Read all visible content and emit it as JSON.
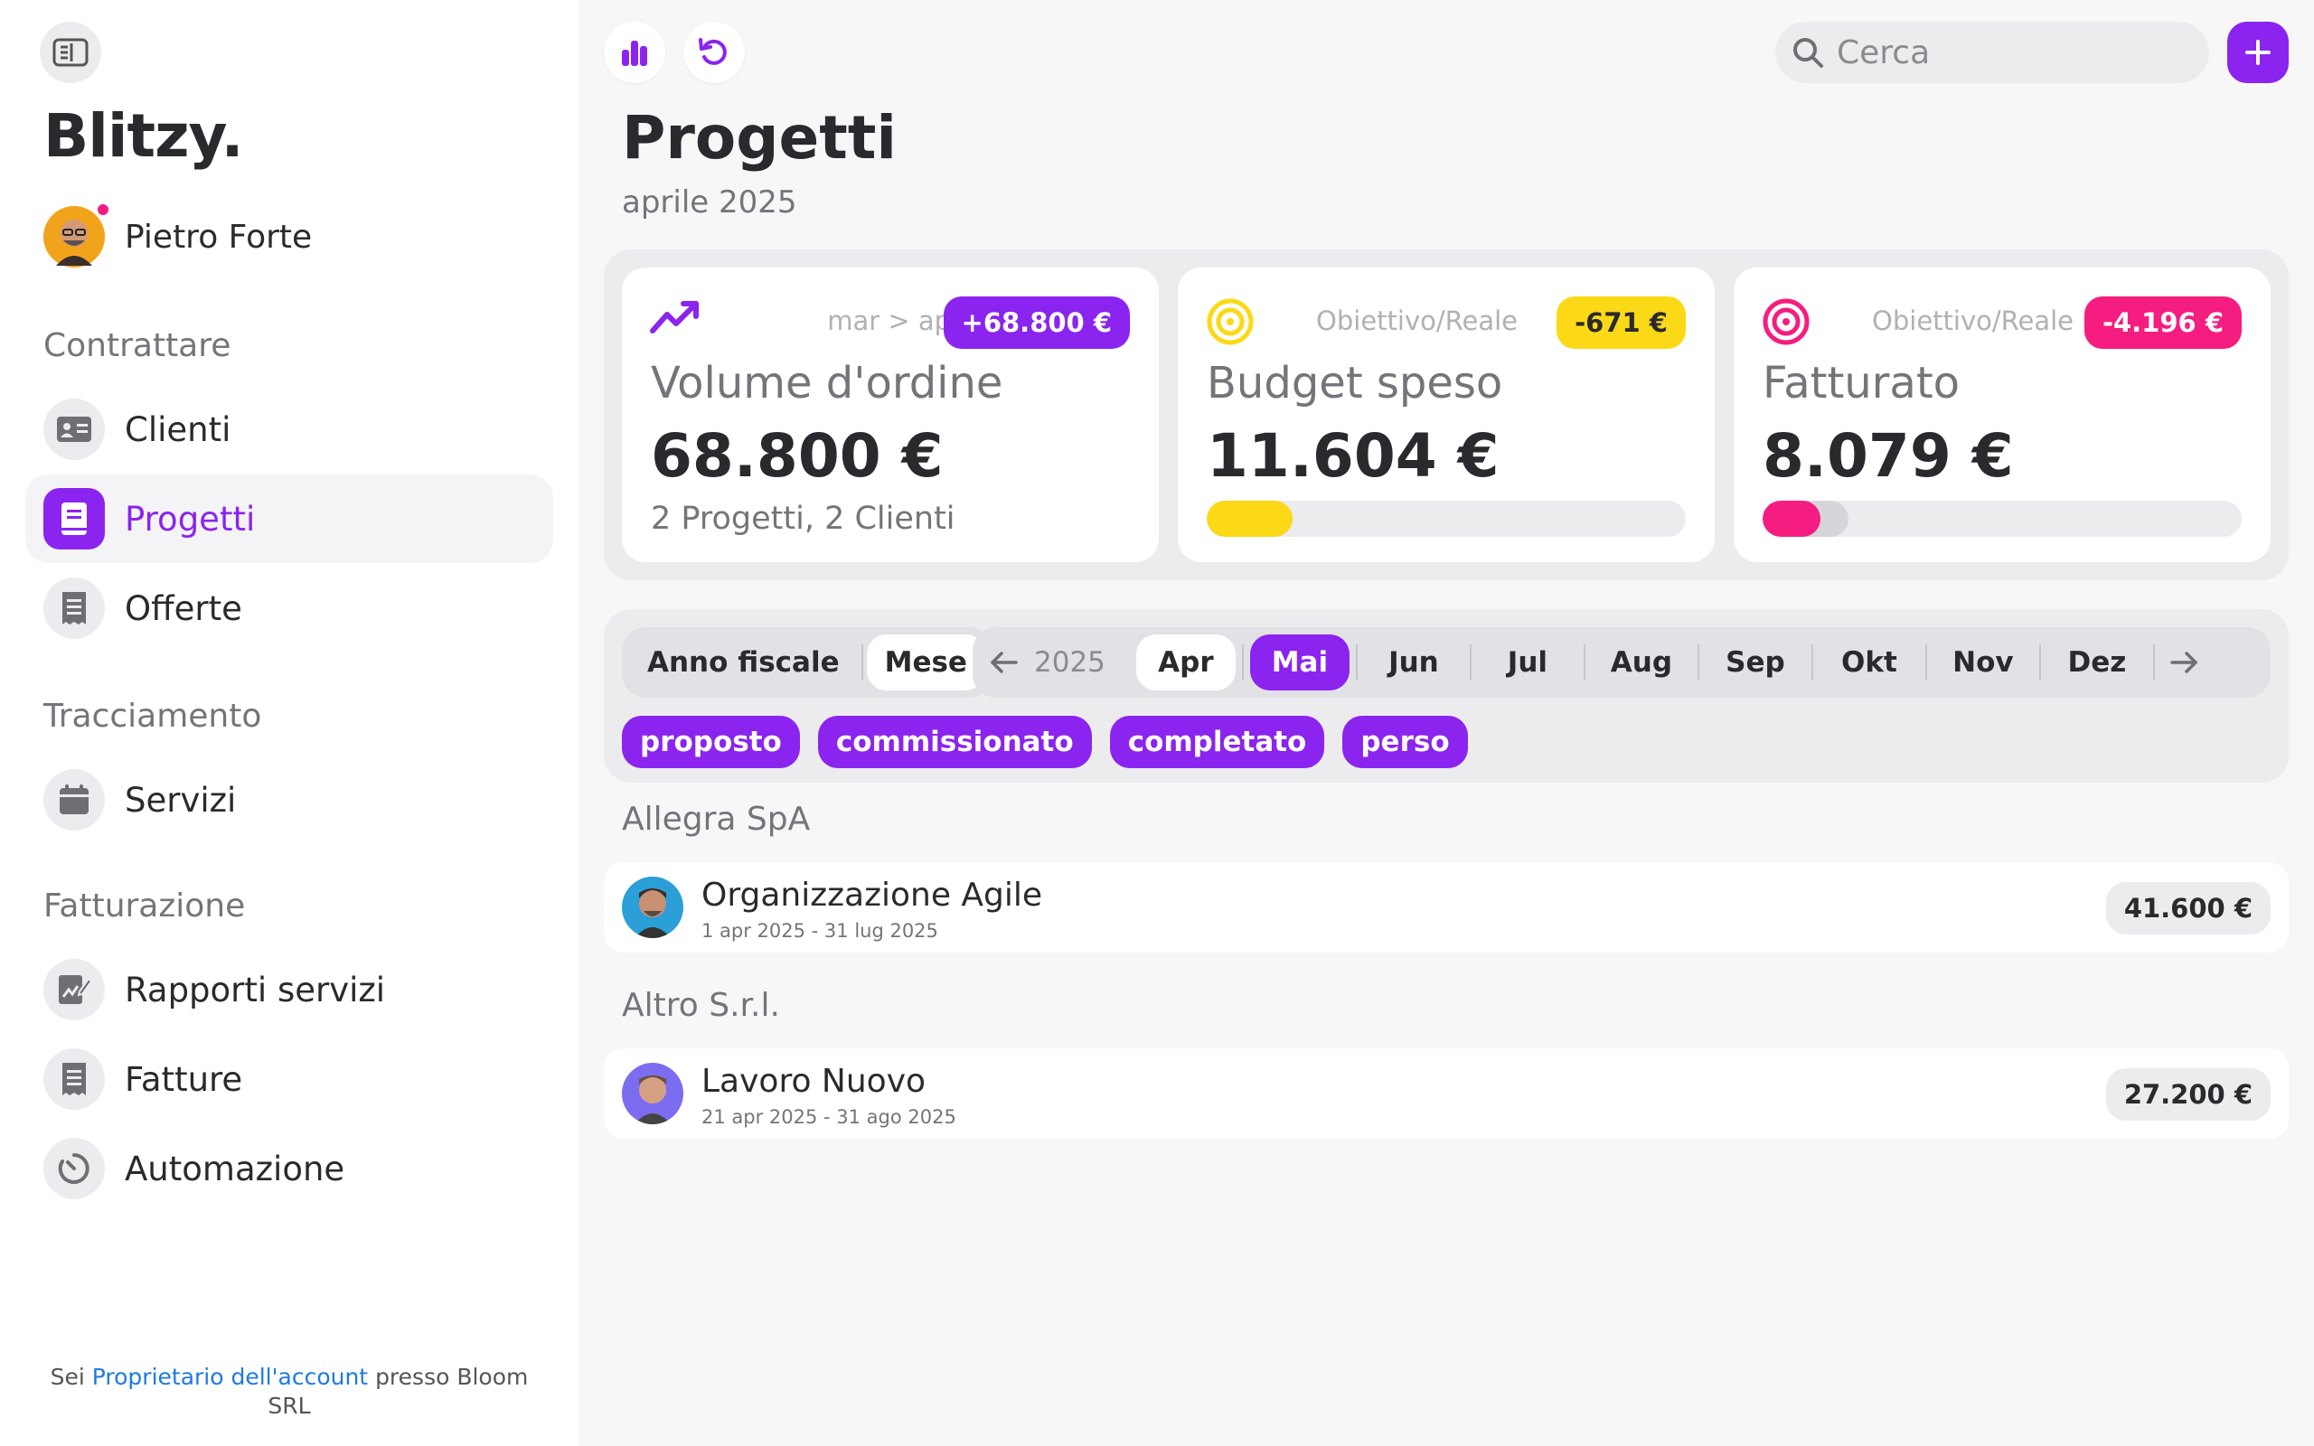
{
  "sidebar": {
    "logo": "Blitzy.",
    "user": {
      "name": "Pietro Forte"
    },
    "sections": [
      {
        "title": "Contrattare",
        "items": [
          {
            "label": "Clienti",
            "icon": "contact-card-icon"
          },
          {
            "label": "Progetti",
            "icon": "book-icon",
            "active": true
          },
          {
            "label": "Offerte",
            "icon": "receipt-icon"
          }
        ]
      },
      {
        "title": "Tracciamento",
        "items": [
          {
            "label": "Servizi",
            "icon": "calendar-icon"
          }
        ]
      },
      {
        "title": "Fatturazione",
        "items": [
          {
            "label": "Rapporti servizi",
            "icon": "report-edit-icon"
          },
          {
            "label": "Fatture",
            "icon": "receipt-icon"
          },
          {
            "label": "Automazione",
            "icon": "timer-icon"
          }
        ]
      }
    ],
    "footer": {
      "prefix": "Sei",
      "link": "Proprietario dell'account",
      "suffix": "presso Bloom SRL"
    }
  },
  "topbar": {
    "search_placeholder": "Cerca"
  },
  "page": {
    "title": "Progetti",
    "subtitle": "aprile 2025"
  },
  "kpis": [
    {
      "title": "Volume d'ordine",
      "meta": "mar > apr",
      "badge": "+68.800 €",
      "value": "68.800 €",
      "desc": "2 Progetti, 2 Clienti",
      "icon": "trending-up-icon"
    },
    {
      "title": "Budget speso",
      "meta": "Obiettivo/Reale",
      "badge": "-671 €",
      "value": "11.604 €",
      "progress": 0.18,
      "icon": "target-icon"
    },
    {
      "title": "Fatturato",
      "meta": "Obiettivo/Reale",
      "badge": "-4.196 €",
      "value": "8.079 €",
      "progress": 0.12,
      "track": 0.18,
      "icon": "target-icon"
    }
  ],
  "colors": {
    "accent": "#8a24ee",
    "yellow": "#fbd916",
    "pink": "#f51d7f"
  },
  "filters": {
    "modes": [
      "Anno fiscale",
      "Mese"
    ],
    "selected_mode": "Mese",
    "year": "2025",
    "months": [
      "Apr",
      "Mai",
      "Jun",
      "Jul",
      "Aug",
      "Sep",
      "Okt",
      "Nov",
      "Dez"
    ],
    "selected_month": "Mai",
    "statuses": [
      "proposto",
      "commissionato",
      "completato",
      "perso"
    ]
  },
  "clients": [
    {
      "name": "Allegra SpA",
      "projects": [
        {
          "name": "Organizzazione Agile",
          "dates": "1 apr 2025 - 31 lug 2025",
          "amount": "41.600 €"
        }
      ]
    },
    {
      "name": "Altro S.r.l.",
      "projects": [
        {
          "name": "Lavoro Nuovo",
          "dates": "21 apr 2025 - 31 ago 2025",
          "amount": "27.200 €"
        }
      ]
    }
  ]
}
